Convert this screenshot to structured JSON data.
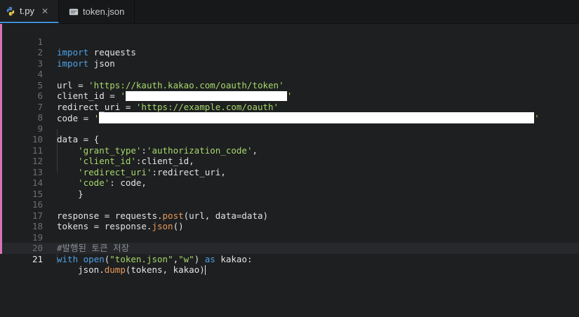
{
  "tabs": [
    {
      "label": "t.py",
      "icon": "python-icon",
      "active": true
    },
    {
      "label": "token.json",
      "icon": "json-file-icon",
      "active": false
    }
  ],
  "line_numbers": [
    "1",
    "2",
    "3",
    "4",
    "5",
    "6",
    "7",
    "8",
    "9",
    "10",
    "11",
    "12",
    "13",
    "14",
    "15",
    "16",
    "17",
    "18",
    "19",
    "20",
    "21"
  ],
  "code": {
    "l1": {
      "kw": "import",
      "rest": " requests"
    },
    "l2": {
      "kw": "import",
      "rest": " json"
    },
    "l4": {
      "a": "url = ",
      "s": "'https://kauth.kakao.com/oauth/token'"
    },
    "l5": {
      "a": "client_id = ",
      "q1": "'",
      "q2": "'"
    },
    "l6": {
      "a": "redirect_uri = ",
      "s": "'https://example.com/oauth'"
    },
    "l7": {
      "a": "code = ",
      "q1": "'",
      "q2": "'"
    },
    "l9": {
      "a": "data = {"
    },
    "l10": {
      "s1": "'grant_type'",
      "a": ":",
      "s2": "'authorization_code'",
      "b": ","
    },
    "l11": {
      "s1": "'client_id'",
      "a": ":client_id,"
    },
    "l12": {
      "s1": "'redirect_uri'",
      "a": ":redirect_uri,"
    },
    "l13": {
      "s1": "'code'",
      "a": ": code,"
    },
    "l14": {
      "a": "}"
    },
    "l16": {
      "a": "response = requests.",
      "f": "post",
      "b": "(url, data=data)"
    },
    "l17": {
      "a": "tokens = response.",
      "f": "json",
      "b": "()"
    },
    "l19": {
      "c": "#발행된 토큰 저장"
    },
    "l20": {
      "kw1": "with",
      "sp": " ",
      "f": "open",
      "a": "(",
      "s1": "\"token.json\"",
      "b": ",",
      "s2": "\"w\"",
      "c": ") ",
      "kw2": "as",
      "d": " kakao:"
    },
    "l21": {
      "a": "json.",
      "f": "dump",
      "b": "(tokens, kakao)"
    }
  },
  "colors": {
    "background": "#1e1f21",
    "keyword": "#4ea1e6",
    "string": "#a6d86a",
    "function": "#e89a5a",
    "gutter_modified": "#d873b5"
  }
}
